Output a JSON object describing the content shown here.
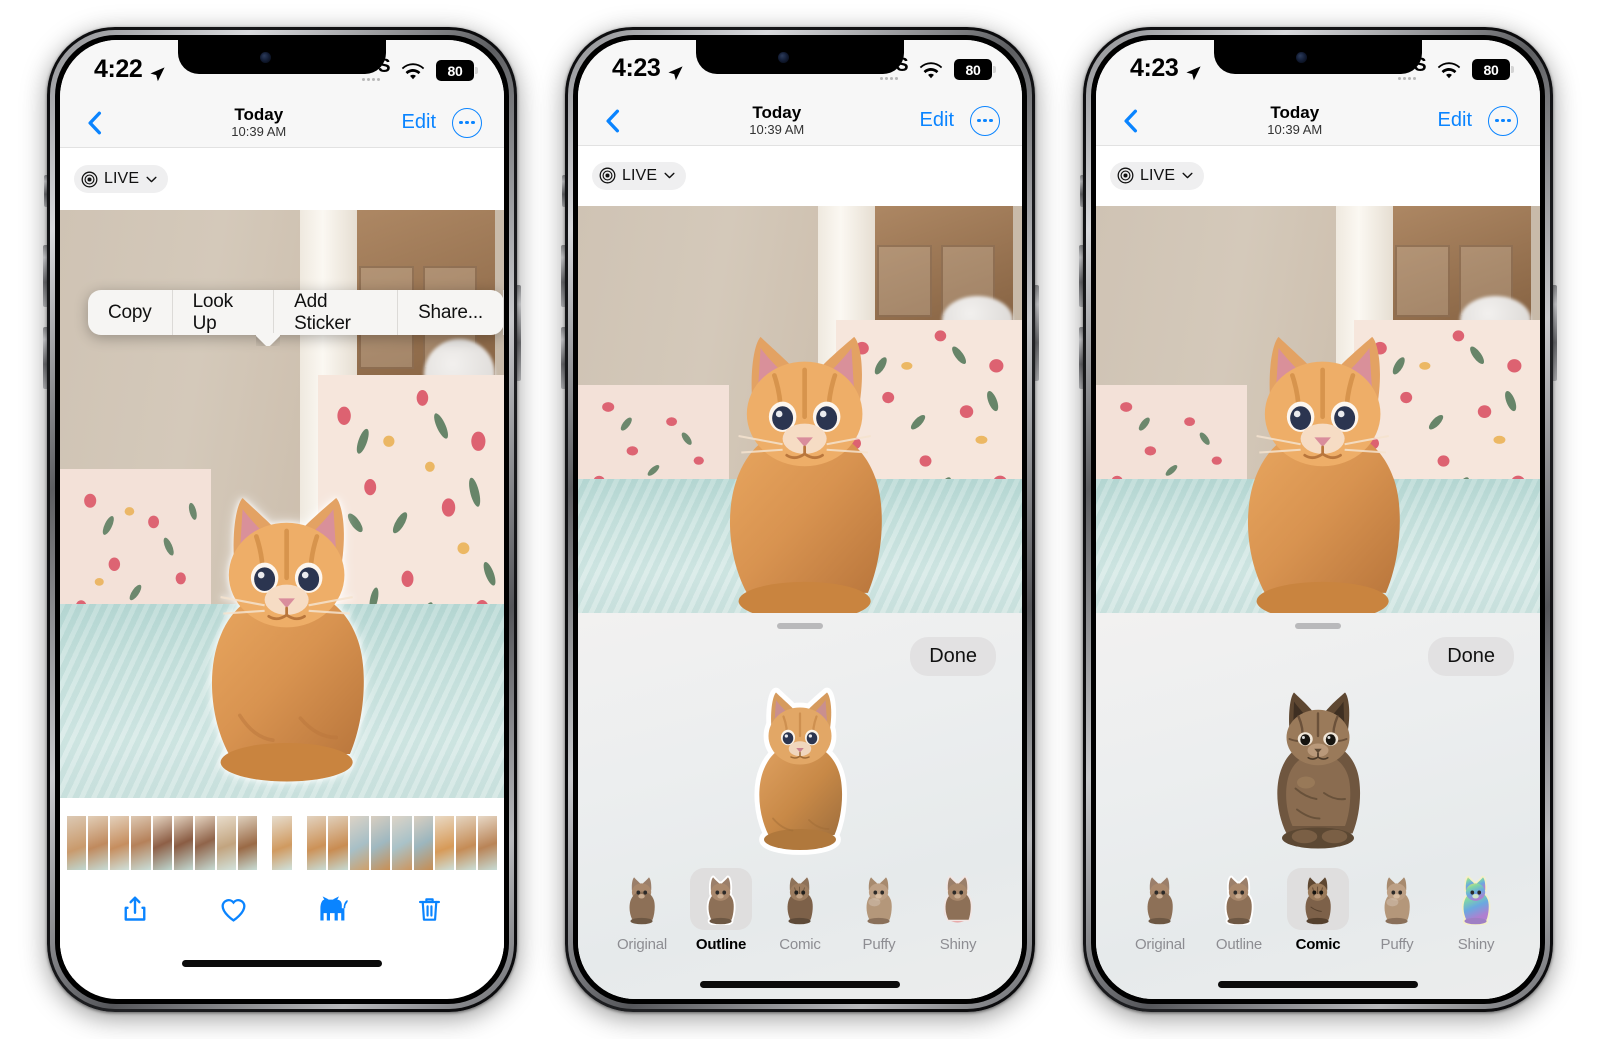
{
  "phones": [
    {
      "id": "phone-1",
      "status": {
        "time": "4:22",
        "location_icon": "location-arrow-icon",
        "sos": "SOS",
        "wifi_icon": "wifi-icon",
        "battery": "80"
      },
      "nav": {
        "back_icon": "chevron-left-icon",
        "title": "Today",
        "subtitle": "10:39 AM",
        "edit": "Edit",
        "more_icon": "ellipsis-circle-icon"
      },
      "live_badge": {
        "icon": "live-photo-icon",
        "label": "LIVE",
        "chevron": "chevron-down-icon"
      },
      "context_menu": {
        "items": [
          "Copy",
          "Look Up",
          "Add Sticker",
          "Share..."
        ]
      },
      "screen_mode": "photo-with-context-menu",
      "toolbar": {
        "share_icon": "share-icon",
        "favorite_icon": "heart-icon",
        "live_sticker_icon": "cat-icon",
        "delete_icon": "trash-icon"
      }
    },
    {
      "id": "phone-2",
      "status": {
        "time": "4:23",
        "location_icon": "location-arrow-icon",
        "sos": "SOS",
        "wifi_icon": "wifi-icon",
        "battery": "80"
      },
      "nav": {
        "back_icon": "chevron-left-icon",
        "title": "Today",
        "subtitle": "10:39 AM",
        "edit": "Edit",
        "more_icon": "ellipsis-circle-icon"
      },
      "live_badge": {
        "icon": "live-photo-icon",
        "label": "LIVE",
        "chevron": "chevron-down-icon"
      },
      "screen_mode": "sticker-sheet",
      "sheet": {
        "done_label": "Done",
        "selected_style": "Outline",
        "styles": [
          "Original",
          "Outline",
          "Comic",
          "Puffy",
          "Shiny"
        ]
      }
    },
    {
      "id": "phone-3",
      "status": {
        "time": "4:23",
        "location_icon": "location-arrow-icon",
        "sos": "SOS",
        "wifi_icon": "wifi-icon",
        "battery": "80"
      },
      "nav": {
        "back_icon": "chevron-left-icon",
        "title": "Today",
        "subtitle": "10:39 AM",
        "edit": "Edit",
        "more_icon": "ellipsis-circle-icon"
      },
      "live_badge": {
        "icon": "live-photo-icon",
        "label": "LIVE",
        "chevron": "chevron-down-icon"
      },
      "screen_mode": "sticker-sheet",
      "sheet": {
        "done_label": "Done",
        "selected_style": "Comic",
        "styles": [
          "Original",
          "Outline",
          "Comic",
          "Puffy",
          "Shiny"
        ]
      }
    }
  ],
  "colors": {
    "accent_blue": "#0a84ff",
    "status_bg": "#f7f7f7",
    "sheet_bg": "#eceeef",
    "selected_tile": "#dfdede"
  }
}
